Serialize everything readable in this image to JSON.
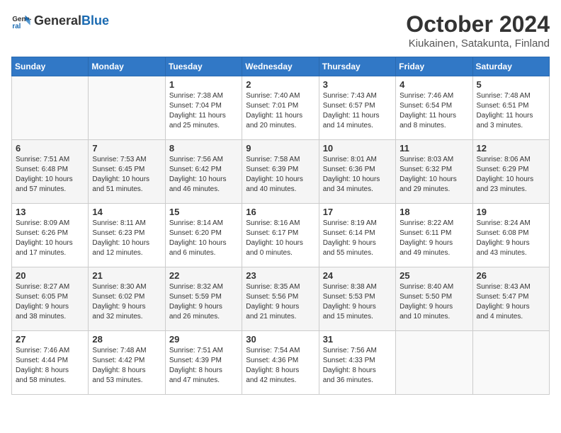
{
  "header": {
    "logo_general": "General",
    "logo_blue": "Blue",
    "title": "October 2024",
    "location": "Kiukainen, Satakunta, Finland"
  },
  "days_of_week": [
    "Sunday",
    "Monday",
    "Tuesday",
    "Wednesday",
    "Thursday",
    "Friday",
    "Saturday"
  ],
  "weeks": [
    [
      {
        "day": "",
        "info": ""
      },
      {
        "day": "",
        "info": ""
      },
      {
        "day": "1",
        "info": "Sunrise: 7:38 AM\nSunset: 7:04 PM\nDaylight: 11 hours\nand 25 minutes."
      },
      {
        "day": "2",
        "info": "Sunrise: 7:40 AM\nSunset: 7:01 PM\nDaylight: 11 hours\nand 20 minutes."
      },
      {
        "day": "3",
        "info": "Sunrise: 7:43 AM\nSunset: 6:57 PM\nDaylight: 11 hours\nand 14 minutes."
      },
      {
        "day": "4",
        "info": "Sunrise: 7:46 AM\nSunset: 6:54 PM\nDaylight: 11 hours\nand 8 minutes."
      },
      {
        "day": "5",
        "info": "Sunrise: 7:48 AM\nSunset: 6:51 PM\nDaylight: 11 hours\nand 3 minutes."
      }
    ],
    [
      {
        "day": "6",
        "info": "Sunrise: 7:51 AM\nSunset: 6:48 PM\nDaylight: 10 hours\nand 57 minutes."
      },
      {
        "day": "7",
        "info": "Sunrise: 7:53 AM\nSunset: 6:45 PM\nDaylight: 10 hours\nand 51 minutes."
      },
      {
        "day": "8",
        "info": "Sunrise: 7:56 AM\nSunset: 6:42 PM\nDaylight: 10 hours\nand 46 minutes."
      },
      {
        "day": "9",
        "info": "Sunrise: 7:58 AM\nSunset: 6:39 PM\nDaylight: 10 hours\nand 40 minutes."
      },
      {
        "day": "10",
        "info": "Sunrise: 8:01 AM\nSunset: 6:36 PM\nDaylight: 10 hours\nand 34 minutes."
      },
      {
        "day": "11",
        "info": "Sunrise: 8:03 AM\nSunset: 6:32 PM\nDaylight: 10 hours\nand 29 minutes."
      },
      {
        "day": "12",
        "info": "Sunrise: 8:06 AM\nSunset: 6:29 PM\nDaylight: 10 hours\nand 23 minutes."
      }
    ],
    [
      {
        "day": "13",
        "info": "Sunrise: 8:09 AM\nSunset: 6:26 PM\nDaylight: 10 hours\nand 17 minutes."
      },
      {
        "day": "14",
        "info": "Sunrise: 8:11 AM\nSunset: 6:23 PM\nDaylight: 10 hours\nand 12 minutes."
      },
      {
        "day": "15",
        "info": "Sunrise: 8:14 AM\nSunset: 6:20 PM\nDaylight: 10 hours\nand 6 minutes."
      },
      {
        "day": "16",
        "info": "Sunrise: 8:16 AM\nSunset: 6:17 PM\nDaylight: 10 hours\nand 0 minutes."
      },
      {
        "day": "17",
        "info": "Sunrise: 8:19 AM\nSunset: 6:14 PM\nDaylight: 9 hours\nand 55 minutes."
      },
      {
        "day": "18",
        "info": "Sunrise: 8:22 AM\nSunset: 6:11 PM\nDaylight: 9 hours\nand 49 minutes."
      },
      {
        "day": "19",
        "info": "Sunrise: 8:24 AM\nSunset: 6:08 PM\nDaylight: 9 hours\nand 43 minutes."
      }
    ],
    [
      {
        "day": "20",
        "info": "Sunrise: 8:27 AM\nSunset: 6:05 PM\nDaylight: 9 hours\nand 38 minutes."
      },
      {
        "day": "21",
        "info": "Sunrise: 8:30 AM\nSunset: 6:02 PM\nDaylight: 9 hours\nand 32 minutes."
      },
      {
        "day": "22",
        "info": "Sunrise: 8:32 AM\nSunset: 5:59 PM\nDaylight: 9 hours\nand 26 minutes."
      },
      {
        "day": "23",
        "info": "Sunrise: 8:35 AM\nSunset: 5:56 PM\nDaylight: 9 hours\nand 21 minutes."
      },
      {
        "day": "24",
        "info": "Sunrise: 8:38 AM\nSunset: 5:53 PM\nDaylight: 9 hours\nand 15 minutes."
      },
      {
        "day": "25",
        "info": "Sunrise: 8:40 AM\nSunset: 5:50 PM\nDaylight: 9 hours\nand 10 minutes."
      },
      {
        "day": "26",
        "info": "Sunrise: 8:43 AM\nSunset: 5:47 PM\nDaylight: 9 hours\nand 4 minutes."
      }
    ],
    [
      {
        "day": "27",
        "info": "Sunrise: 7:46 AM\nSunset: 4:44 PM\nDaylight: 8 hours\nand 58 minutes."
      },
      {
        "day": "28",
        "info": "Sunrise: 7:48 AM\nSunset: 4:42 PM\nDaylight: 8 hours\nand 53 minutes."
      },
      {
        "day": "29",
        "info": "Sunrise: 7:51 AM\nSunset: 4:39 PM\nDaylight: 8 hours\nand 47 minutes."
      },
      {
        "day": "30",
        "info": "Sunrise: 7:54 AM\nSunset: 4:36 PM\nDaylight: 8 hours\nand 42 minutes."
      },
      {
        "day": "31",
        "info": "Sunrise: 7:56 AM\nSunset: 4:33 PM\nDaylight: 8 hours\nand 36 minutes."
      },
      {
        "day": "",
        "info": ""
      },
      {
        "day": "",
        "info": ""
      }
    ]
  ]
}
